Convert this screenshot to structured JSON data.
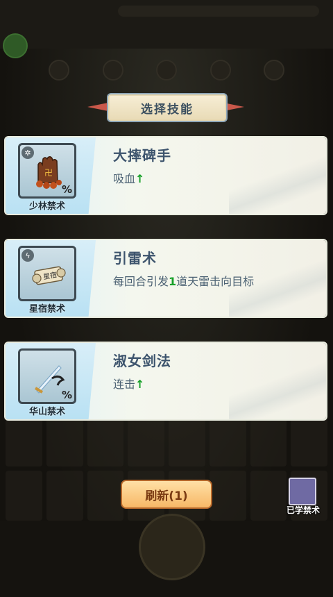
{
  "header": {
    "title": "选择技能"
  },
  "skills": [
    {
      "name": "大摔碑手",
      "desc_parts": [
        "吸血"
      ],
      "arrow": "↑",
      "school": "少林禁术",
      "icon": "relic-hand-icon"
    },
    {
      "name": "引雷术",
      "desc_parts": [
        "每回合引发",
        "1",
        "道天雷击向目标"
      ],
      "school": "星宿禁术",
      "icon": "scroll-icon"
    },
    {
      "name": "淑女剑法",
      "desc_parts": [
        "连击"
      ],
      "arrow": "↑",
      "school": "华山禁术",
      "icon": "sword-icon"
    }
  ],
  "badge_glyphs": [
    "✲",
    "ϟ",
    ""
  ],
  "pct_symbol": "%",
  "refresh_button": {
    "label": "刷新(1)"
  },
  "learned": {
    "label": "已学禁术"
  },
  "colors": {
    "highlight": "#16a028",
    "title_text": "#3d546d",
    "button": "#f7b867"
  }
}
